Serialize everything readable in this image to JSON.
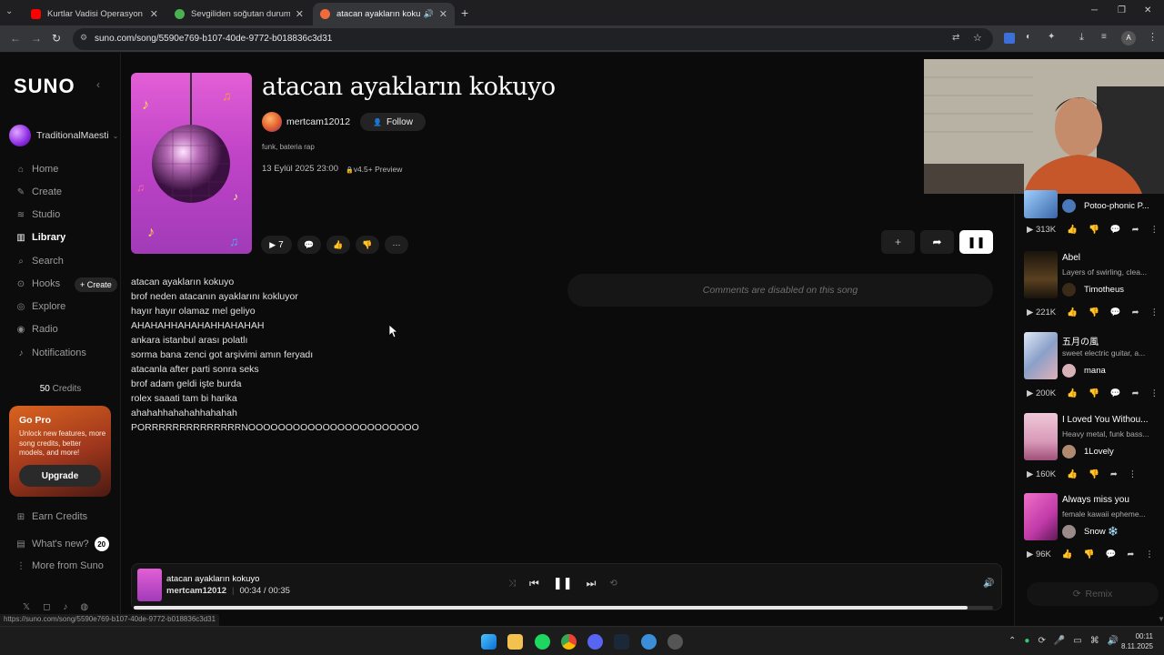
{
  "browser": {
    "tabs": [
      {
        "title": "Kurtlar Vadisi Operasyon Müziği",
        "favicon_color": "#ff0000"
      },
      {
        "title": "Sevgiliden soğutan durumlar -",
        "favicon_color": "#4caf50"
      },
      {
        "title": "atacan ayakların kokuyo by",
        "favicon_color": "#f06a3c"
      }
    ],
    "url": "suno.com/song/5590e769-b107-40de-9772-b018836c3d31",
    "status_url": "https://suno.com/song/5590e769-b107-40de-9772-b018836c3d31"
  },
  "sidebar": {
    "logo": "SUNO",
    "user": "TraditionalMaesti",
    "nav": [
      {
        "label": "Home",
        "icon": "home-icon"
      },
      {
        "label": "Create",
        "icon": "create-icon"
      },
      {
        "label": "Studio",
        "icon": "studio-icon"
      },
      {
        "label": "Library",
        "icon": "library-icon"
      },
      {
        "label": "Search",
        "icon": "search-icon"
      },
      {
        "label": "Hooks",
        "icon": "hooks-icon"
      },
      {
        "label": "Explore",
        "icon": "explore-icon"
      },
      {
        "label": "Radio",
        "icon": "radio-icon"
      },
      {
        "label": "Notifications",
        "icon": "bell-icon"
      }
    ],
    "hooks_create": "+ Create",
    "credits_count": "50",
    "credits_label": "Credits",
    "gopro": {
      "title": "Go Pro",
      "desc": "Unlock new features, more song credits, better models, and more!",
      "button": "Upgrade"
    },
    "bottom": [
      {
        "label": "Earn Credits"
      },
      {
        "label": "What's new?"
      },
      {
        "label": "More from Suno"
      }
    ],
    "whats_new_badge": "20"
  },
  "song": {
    "title": "atacan ayakların kokuyo",
    "artist": "mertcam12012",
    "follow": "Follow",
    "tags": "funk, bateria rap",
    "date": "13 Eylül 2025 23:00",
    "model": "v4.5+ Preview",
    "plays": "7",
    "lyrics": [
      "atacan ayakların kokuyo",
      "brof neden atacanın ayaklarını kokluyor",
      "hayır hayır olamaz mel geliyo",
      "AHAHAHHAHAHAHHAHAHAH",
      "ankara istanbul arası polatlı",
      "sorma bana zenci got arşivimi amın feryadı",
      "atacanla after parti sonra seks",
      "brof adam geldi işte burda",
      "rolex saaati tam bi harika",
      "ahahahhahahahhahahah",
      "PORRRRRRRRRRRRRRNOOOOOOOOOOOOOOOOOOOOOOO"
    ],
    "comments_disabled": "Comments are disabled on this song"
  },
  "player": {
    "title": "atacan ayakların kokuyo",
    "artist": "mertcam12012",
    "current": "00:34 /",
    "total": "00:35",
    "progress": 0.97
  },
  "feed": [
    {
      "title": "",
      "desc": "",
      "artist": "Potoo-phonic P...",
      "plays": "313K",
      "thumb": "#4a78b8"
    },
    {
      "title": "Abel",
      "desc": "Layers of swirling, clea...",
      "artist": "Timotheus",
      "plays": "221K",
      "thumb": "#3a2a18"
    },
    {
      "title": "五月の風",
      "desc": "sweet electric guitar, a...",
      "artist": "mana",
      "plays": "200K",
      "thumb": "#8aa0c8"
    },
    {
      "title": "I Loved You Withou...",
      "desc": "Heavy metal, funk bass...",
      "artist": "1Lovely",
      "plays": "160K",
      "thumb": "#d89ab8"
    },
    {
      "title": "Always miss you",
      "desc": "female kawaii epheme...",
      "artist": "Snow ❄️",
      "plays": "96K",
      "thumb": "#c03aa8"
    }
  ],
  "remix": "Remix",
  "clock": {
    "time": "00:11",
    "date": "8.11.2025"
  }
}
